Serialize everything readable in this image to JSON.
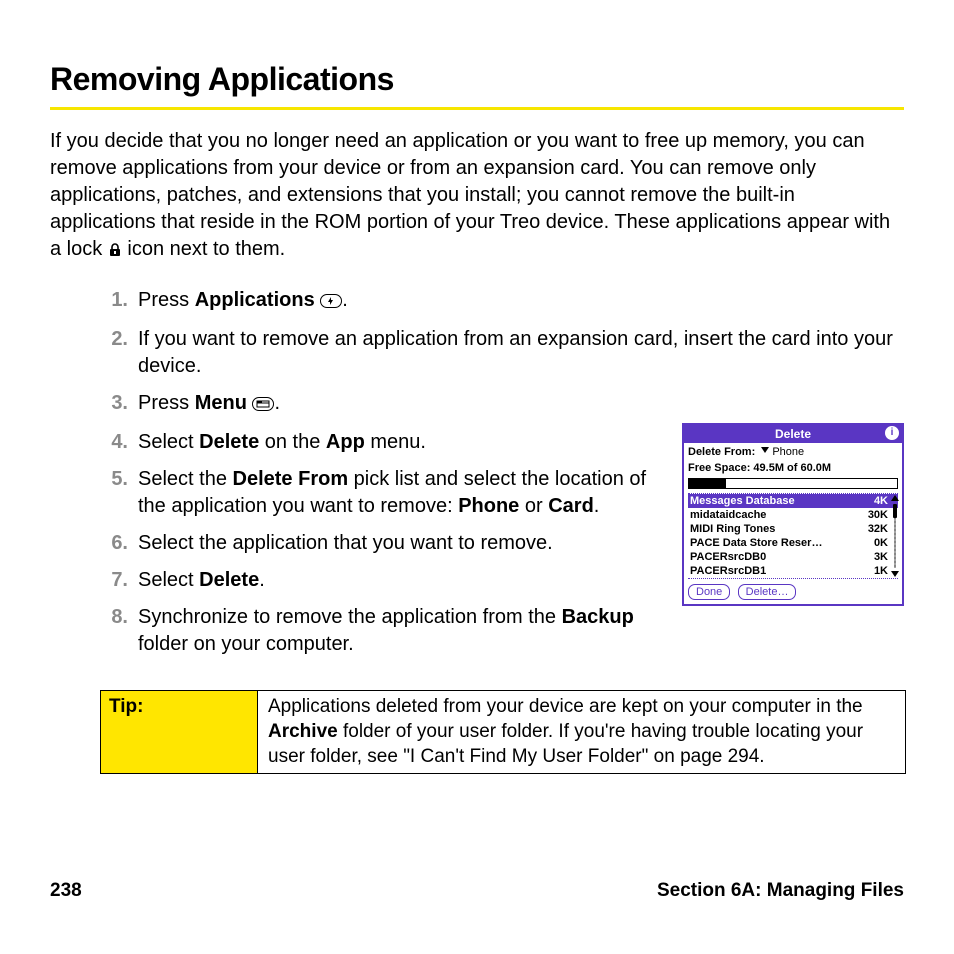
{
  "title": "Removing Applications",
  "intro": {
    "p1a": "If you decide that you no longer need an application or you want to free up memory, you can remove applications from your device or from an expansion card. You can remove only applications, patches, and extensions that you install; you cannot remove the built-in applications that reside in the ROM portion of your Treo device. These applications appear with a lock ",
    "p1b": " icon next to them."
  },
  "steps": [
    {
      "n": "1.",
      "pre": "Press ",
      "b1": "Applications",
      "post": " "
    },
    {
      "n": "2.",
      "text": "If you want to remove an application from an expansion card, insert the card into your device."
    },
    {
      "n": "3.",
      "pre": "Press ",
      "b1": "Menu",
      "post": " "
    },
    {
      "n": "4.",
      "pre": "Select ",
      "b1": "Delete",
      "mid": " on the ",
      "b2": "App",
      "post": " menu."
    },
    {
      "n": "5.",
      "pre": "Select the ",
      "b1": "Delete From",
      "mid": " pick list and select the location of the application you want to remove: ",
      "b2": "Phone",
      "mid2": " or ",
      "b3": "Card",
      "post": "."
    },
    {
      "n": "6.",
      "text": "Select the application that you want to remove."
    },
    {
      "n": "7.",
      "pre": "Select ",
      "b1": "Delete",
      "post": "."
    },
    {
      "n": "8.",
      "pre": "Synchronize to remove the application from the ",
      "b1": "Backup",
      "post": " folder on your computer."
    }
  ],
  "screenshot": {
    "title": "Delete",
    "from_label": "Delete From:",
    "from_value": "Phone",
    "free_space": "Free Space: 49.5M of 60.0M",
    "items": [
      {
        "name": "Messages Database",
        "size": "4K",
        "sel": true
      },
      {
        "name": "midataidcache",
        "size": "30K"
      },
      {
        "name": "MIDI Ring Tones",
        "size": "32K"
      },
      {
        "name": "PACE Data Store Reser…",
        "size": "0K"
      },
      {
        "name": "PACERsrcDB0",
        "size": "3K"
      },
      {
        "name": "PACERsrcDB1",
        "size": "1K"
      }
    ],
    "btn_done": "Done",
    "btn_delete": "Delete…"
  },
  "tip": {
    "label": "Tip:",
    "t1": "Applications deleted from your device are kept on your computer in the ",
    "b1": "Archive",
    "t2": " folder of your user folder. If you're having trouble locating your user folder, see \"I Can't Find My User Folder\" on page 294."
  },
  "footer": {
    "page": "238",
    "section": "Section 6A: Managing Files"
  }
}
